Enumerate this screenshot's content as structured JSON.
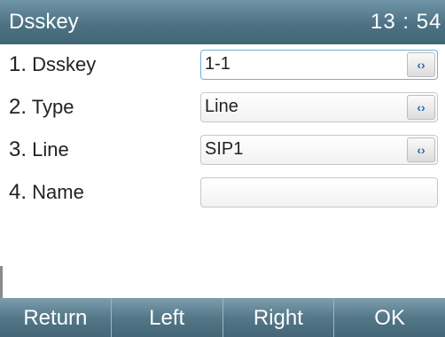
{
  "header": {
    "title": "Dsskey",
    "time": "13 : 54"
  },
  "rows": [
    {
      "num": "1.",
      "label": "Dsskey",
      "value": "1-1",
      "has_switch": true,
      "switch_icon": "left-right-arrows-icon"
    },
    {
      "num": "2.",
      "label": "Type",
      "value": "Line",
      "has_switch": true,
      "switch_icon": "left-right-arrows-icon"
    },
    {
      "num": "3.",
      "label": "Line",
      "value": "SIP1",
      "has_switch": true,
      "switch_icon": "left-right-arrows-icon"
    },
    {
      "num": "4.",
      "label": "Name",
      "value": "",
      "has_switch": false
    }
  ],
  "softkeys": [
    "Return",
    "Left",
    "Right",
    "OK"
  ],
  "colors": {
    "title_bar": "#4c7284",
    "softkey_bar": "#547888",
    "focus_border": "#6fb0d8",
    "switch_glyph": "#2c6aa8"
  }
}
